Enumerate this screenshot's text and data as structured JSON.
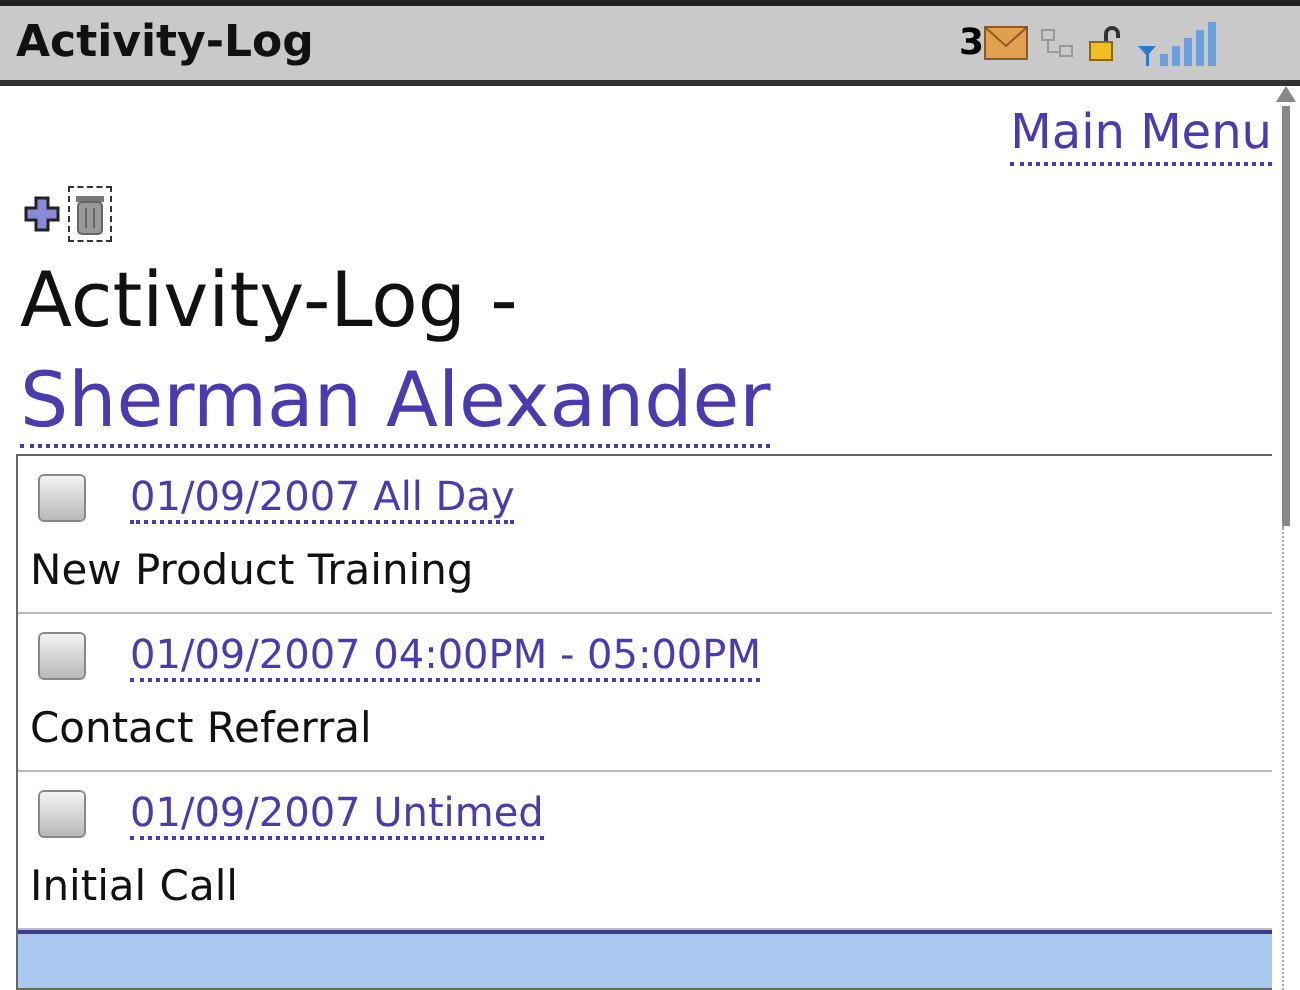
{
  "title_bar": {
    "title": "Activity-Log",
    "message_count": "3"
  },
  "main_menu_link": "Main Menu",
  "heading": {
    "prefix": "Activity-Log - ",
    "contact": "Sherman Alexander"
  },
  "activities": [
    {
      "date": "01/09/2007 All Day",
      "title": "New Product Training",
      "checked": false
    },
    {
      "date": "01/09/2007 04:00PM - 05:00PM",
      "title": "Contact Referral",
      "checked": false
    },
    {
      "date": "01/09/2007 Untimed",
      "title": "Initial Call",
      "checked": false
    }
  ]
}
